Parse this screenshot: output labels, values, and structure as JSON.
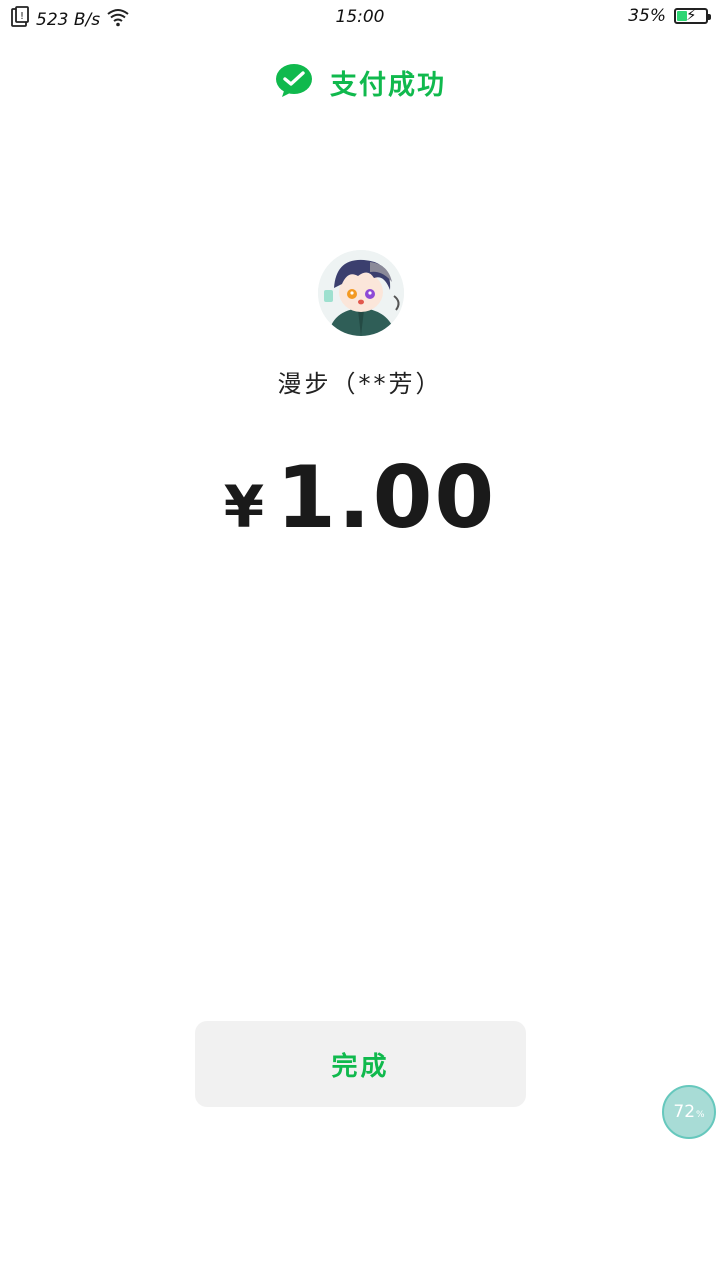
{
  "status_bar": {
    "net_speed": "523 B/s",
    "time": "15:00",
    "battery": "35%",
    "battery_level": 0.35
  },
  "header": {
    "title": "支付成功",
    "icon": "wechat-pay-icon",
    "accent_color": "#10b94d"
  },
  "payee": {
    "name": "漫步（**芳）",
    "avatar": "anime-avatar"
  },
  "payment": {
    "currency_symbol": "¥",
    "amount": "1.00"
  },
  "actions": {
    "done_label": "完成"
  },
  "floating_widget": {
    "value": "72",
    "unit": "%"
  }
}
